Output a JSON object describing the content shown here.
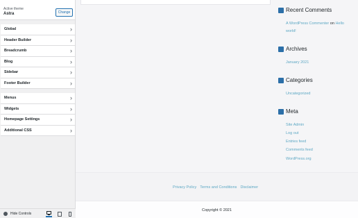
{
  "sidebar": {
    "active_theme_label": "Active theme",
    "theme_name": "Astra",
    "change_label": "Change",
    "sections_primary": [
      {
        "label": "Global"
      },
      {
        "label": "Header Builder"
      },
      {
        "label": "Breadcrumb"
      },
      {
        "label": "Blog"
      },
      {
        "label": "Sidebar"
      },
      {
        "label": "Footer Builder"
      }
    ],
    "sections_secondary": [
      {
        "label": "Menus"
      },
      {
        "label": "Widgets"
      },
      {
        "label": "Homepage Settings"
      },
      {
        "label": "Additional CSS"
      }
    ],
    "hide_controls_label": "Hide Controls",
    "devices": [
      "desktop-icon",
      "tablet-icon",
      "mobile-icon"
    ],
    "active_device": "desktop"
  },
  "preview": {
    "widgets": {
      "recent_comments": {
        "title": "Recent Comments",
        "author": "A WordPress Commenter",
        "on": "on",
        "post_line1": "Hello",
        "post_line2": "world!"
      },
      "archives": {
        "title": "Archives",
        "items": [
          "January 2021"
        ]
      },
      "categories": {
        "title": "Categories",
        "items": [
          "Uncategorized"
        ]
      },
      "meta": {
        "title": "Meta",
        "items": [
          "Site Admin",
          "Log out",
          "Entries feed",
          "Comments feed",
          "WordPress.org"
        ]
      }
    },
    "footer_links": [
      "Privacy Policy",
      "Terms and Conditions",
      "Disclaimer"
    ],
    "copyright": "Copyright © 2021"
  },
  "colors": {
    "accent": "#2271b1",
    "link": "#5ea8c4",
    "widget_icon": "#2c6fa8"
  }
}
